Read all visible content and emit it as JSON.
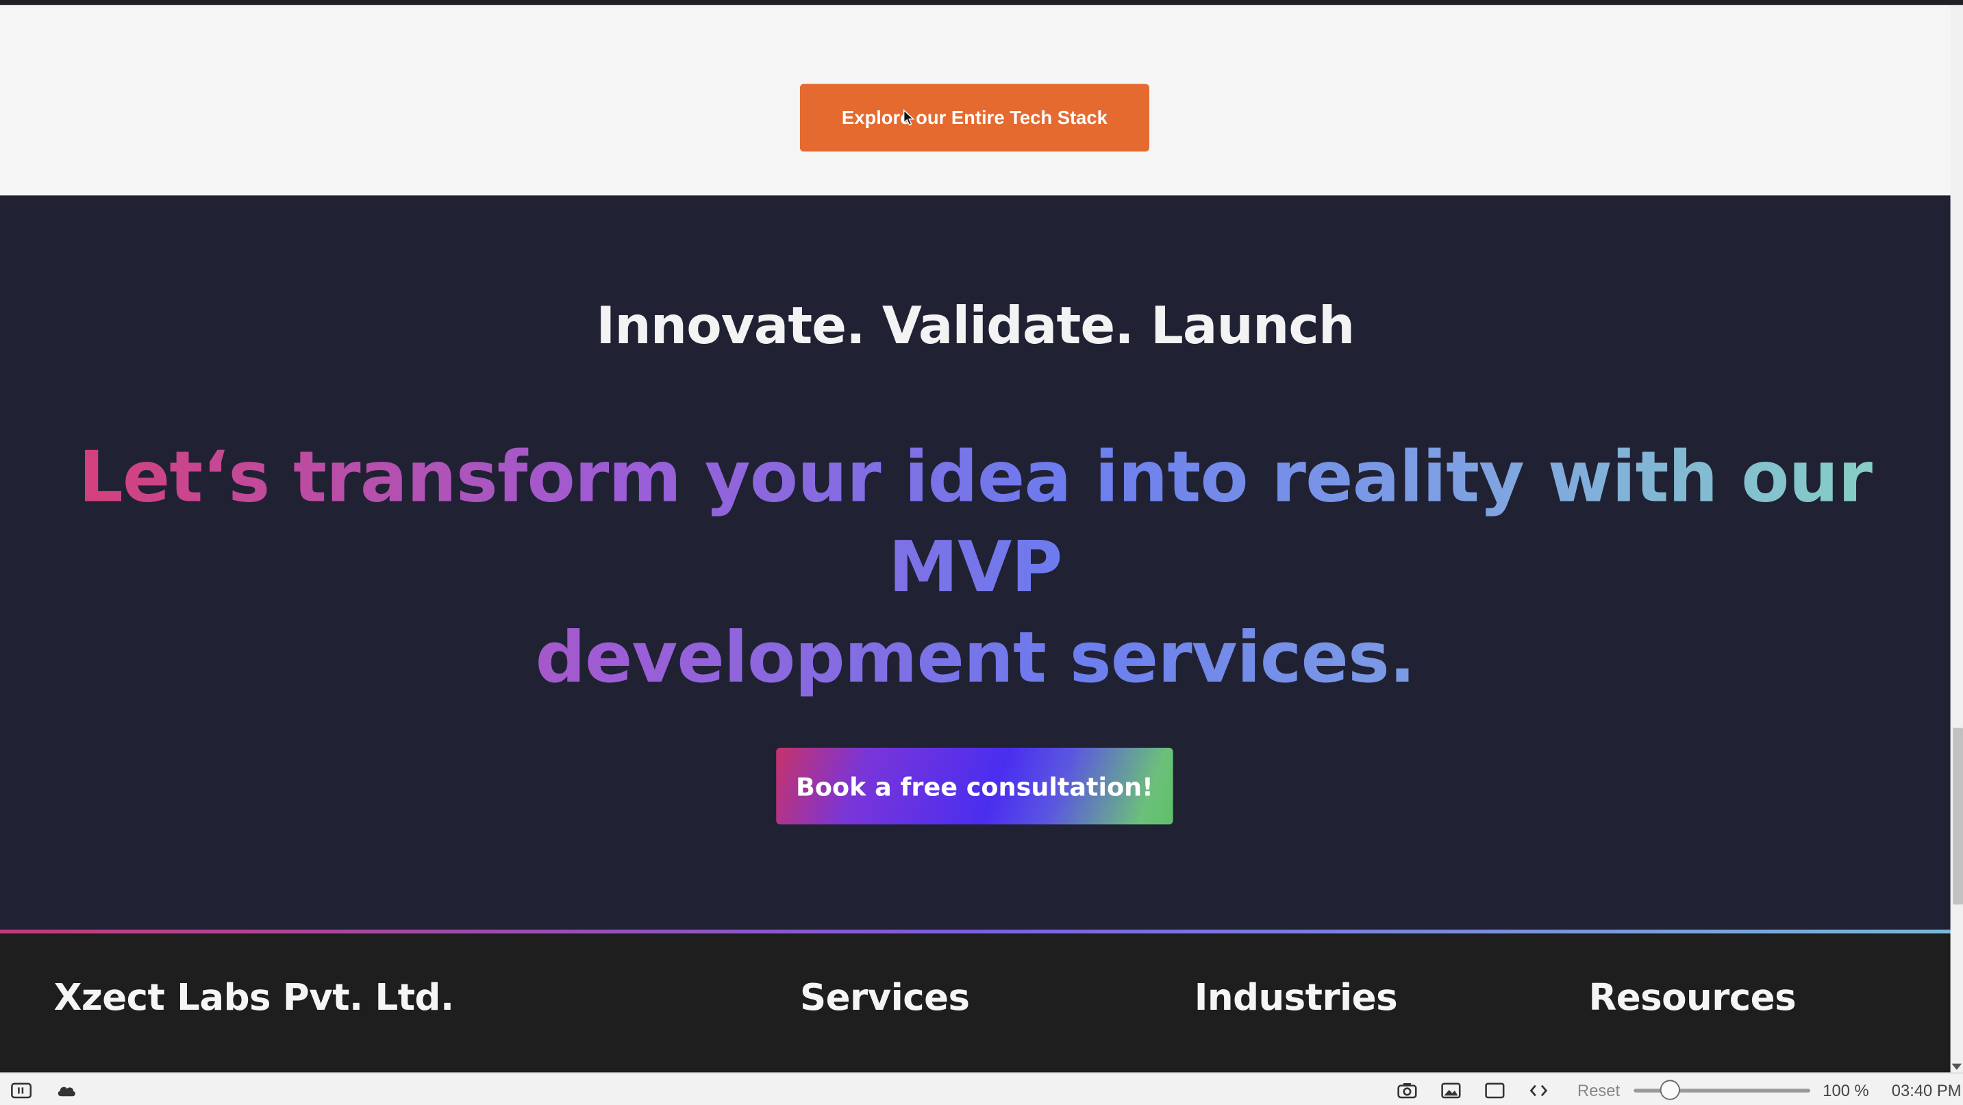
{
  "explore": {
    "label": "Explore our Entire Tech Stack"
  },
  "hero": {
    "tagline": "Innovate. Validate. Launch",
    "headline_line1": "Let‘s transform your idea into reality with our MVP",
    "headline_line2": "development services.",
    "cta_label": "Book a free consultation!"
  },
  "footer": {
    "company": "Xzect Labs Pvt. Ltd.",
    "services": "Services",
    "industries": "Industries",
    "resources": "Resources"
  },
  "statusbar": {
    "reset_label": "Reset",
    "zoom": "100 %",
    "time": "03:40 PM"
  },
  "colors": {
    "explore_button": "#e56a2f",
    "dark_background": "#202234",
    "footer_background": "#1e1e1e"
  }
}
